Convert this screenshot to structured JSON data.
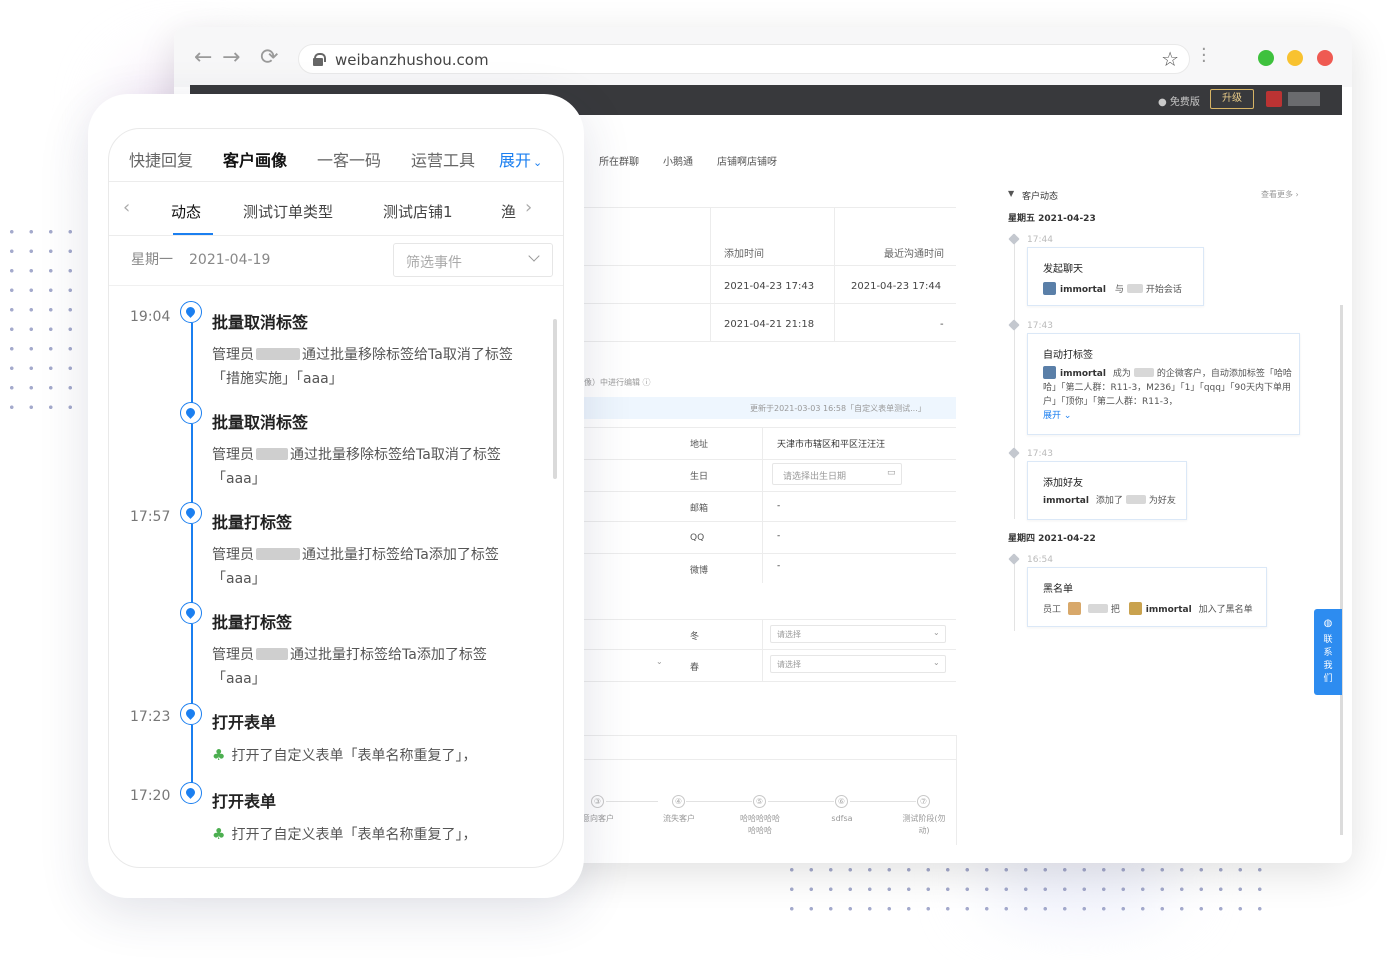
{
  "browser": {
    "url": "weibanzhushou.com",
    "app_bar": {
      "free_label": "● 免费版",
      "upgrade_label": "升级"
    }
  },
  "desktop": {
    "tabs": [
      "所在群聊",
      "小鹅通",
      "店铺啊店铺呀"
    ],
    "table": {
      "headers": [
        "添加时间",
        "最近沟通时间"
      ],
      "rows": [
        [
          "2021-04-23 17:43",
          "2021-04-23 17:44"
        ],
        [
          "2021-04-21 21:18",
          "-"
        ]
      ]
    },
    "edit_hint": "像）中进行编辑 ⓘ",
    "update_notice": "更新于2021-03-03 16:58「自定义表单测试...」",
    "fields": [
      {
        "label": "地址",
        "value": "天津市市辖区和平区汪汪汪"
      },
      {
        "label": "生日",
        "value": "请选择出生日期"
      },
      {
        "label": "邮箱",
        "value": "-"
      },
      {
        "label": "QQ",
        "value": "-"
      },
      {
        "label": "微博",
        "value": "-"
      }
    ],
    "season_fields": [
      {
        "label": "冬",
        "placeholder": "请选择"
      },
      {
        "label": "春",
        "placeholder": "请选择"
      }
    ],
    "stages": [
      {
        "num": "③",
        "name": "意向客户"
      },
      {
        "num": "④",
        "name": "流失客户"
      },
      {
        "num": "⑤",
        "name": "哈哈哈哈哈哈哈哈"
      },
      {
        "num": "⑥",
        "name": "sdfsa"
      },
      {
        "num": "⑦",
        "name": "测试阶段(勿动)"
      }
    ],
    "activity": {
      "title": "客户动态",
      "more": "查看更多 ›",
      "dates": [
        "星期五 2021-04-23",
        "星期四 2021-04-22"
      ],
      "events": [
        {
          "time": "17:44",
          "title": "发起聊天",
          "user": "immortal",
          "mid": "与",
          "tail": "开始会话"
        },
        {
          "time": "17:43",
          "title": "自动打标签",
          "user": "immortal",
          "mid": "成为",
          "tail": "的企微客户，自动添加标签",
          "tags": "「哈哈哈」「第二人群：R11-3，M236」「1」「qqq」「90天内下单用户」「顶你」「第二人群：R11-3，",
          "expand": "展开 ⌄"
        },
        {
          "time": "17:43",
          "title": "添加好友",
          "user": "immortal",
          "mid": "添加了",
          "tail": "为好友"
        },
        {
          "time": "16:54",
          "title": "黑名单",
          "pre": "员工",
          "mid": "把",
          "user": "immortal",
          "tail": "加入了黑名单"
        }
      ]
    },
    "contact": "联系我们"
  },
  "phone": {
    "top_tabs": [
      "快捷回复",
      "客户画像",
      "一客一码",
      "运营工具"
    ],
    "expand": "展开",
    "sub_tabs": [
      "动态",
      "测试订单类型",
      "测试店铺1",
      "渔"
    ],
    "weekday": "星期一",
    "date": "2021-04-19",
    "filter_placeholder": "筛选事件",
    "events": [
      {
        "time": "19:04",
        "title": "批量取消标签",
        "prefix": "管理员",
        "text": "通过批量移除标签给Ta取消了标签 「措施实施」「aaa」"
      },
      {
        "time": "",
        "title": "批量取消标签",
        "prefix": "管理员",
        "text": "通过批量移除标签给Ta取消了标签 「aaa」"
      },
      {
        "time": "17:57",
        "title": "批量打标签",
        "prefix": "管理员",
        "text": "通过批量打标签给Ta添加了标签 「aaa」"
      },
      {
        "time": "",
        "title": "批量打标签",
        "prefix": "管理员",
        "text": "通过批量打标签给Ta添加了标签 「aaa」"
      },
      {
        "time": "17:23",
        "title": "打开表单",
        "prefix": "",
        "text": "打开了自定义表单「表单名称重复了」，"
      },
      {
        "time": "17:20",
        "title": "打开表单",
        "prefix": "",
        "text": "打开了自定义表单「表单名称重复了」，"
      }
    ]
  }
}
